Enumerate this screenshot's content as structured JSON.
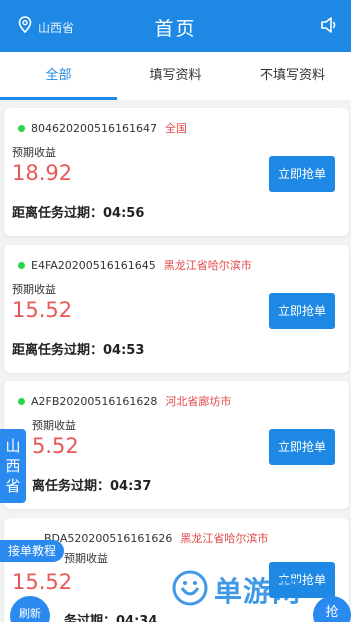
{
  "header": {
    "location": "山西省",
    "title": "首页"
  },
  "tabs": [
    {
      "label": "全部"
    },
    {
      "label": "填写资料"
    },
    {
      "label": "不填写资料"
    }
  ],
  "cards": [
    {
      "order_id": "804620200516161647",
      "region": "全国",
      "label": "预期收益",
      "amount": "18.92",
      "expire_text": "距离任务过期：04:56",
      "button": "立即抢单"
    },
    {
      "order_id": "E4FA20200516161645",
      "region": "黑龙江省哈尔滨市",
      "label": "预期收益",
      "amount": "15.52",
      "expire_text": "距离任务过期：04:53",
      "button": "立即抢单"
    },
    {
      "order_id": "A2FB20200516161628",
      "region": "河北省廊坊市",
      "label": "预期收益",
      "amount": "5.52",
      "expire_text": "离任务过期：04:37",
      "button": "立即抢单"
    },
    {
      "order_id": "BDA520200516161626",
      "region": "黑龙江省哈尔滨市",
      "label": "预期收益",
      "amount": "15.52",
      "expire_text": "务过期：04:34",
      "button": "立即抢单"
    }
  ],
  "floating": {
    "side_region": [
      "山",
      "西",
      "省"
    ],
    "tutorial": "接单教程",
    "refresh": "刷新",
    "right_button": "抢"
  },
  "watermark": {
    "text": "单游网"
  },
  "colors": {
    "primary": "#1e88e5",
    "amount": "#e85858",
    "region": "#e04a4a",
    "online_dot": "#2bd44a"
  },
  "icons": {
    "location": "location-pin-icon",
    "sound": "speaker-icon"
  }
}
